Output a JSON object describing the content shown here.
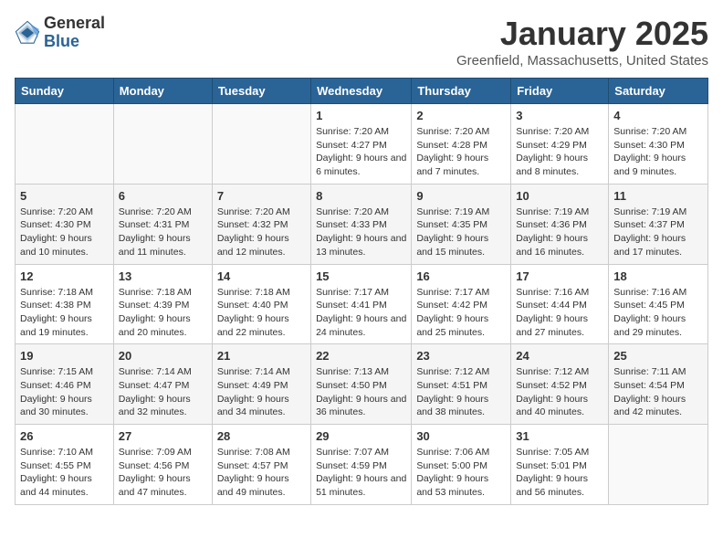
{
  "header": {
    "logo": {
      "general": "General",
      "blue": "Blue"
    },
    "title": "January 2025",
    "subtitle": "Greenfield, Massachusetts, United States"
  },
  "weekdays": [
    "Sunday",
    "Monday",
    "Tuesday",
    "Wednesday",
    "Thursday",
    "Friday",
    "Saturday"
  ],
  "weeks": [
    [
      {
        "day": "",
        "info": ""
      },
      {
        "day": "",
        "info": ""
      },
      {
        "day": "",
        "info": ""
      },
      {
        "day": "1",
        "info": "Sunrise: 7:20 AM\nSunset: 4:27 PM\nDaylight: 9 hours and 6 minutes."
      },
      {
        "day": "2",
        "info": "Sunrise: 7:20 AM\nSunset: 4:28 PM\nDaylight: 9 hours and 7 minutes."
      },
      {
        "day": "3",
        "info": "Sunrise: 7:20 AM\nSunset: 4:29 PM\nDaylight: 9 hours and 8 minutes."
      },
      {
        "day": "4",
        "info": "Sunrise: 7:20 AM\nSunset: 4:30 PM\nDaylight: 9 hours and 9 minutes."
      }
    ],
    [
      {
        "day": "5",
        "info": "Sunrise: 7:20 AM\nSunset: 4:30 PM\nDaylight: 9 hours and 10 minutes."
      },
      {
        "day": "6",
        "info": "Sunrise: 7:20 AM\nSunset: 4:31 PM\nDaylight: 9 hours and 11 minutes."
      },
      {
        "day": "7",
        "info": "Sunrise: 7:20 AM\nSunset: 4:32 PM\nDaylight: 9 hours and 12 minutes."
      },
      {
        "day": "8",
        "info": "Sunrise: 7:20 AM\nSunset: 4:33 PM\nDaylight: 9 hours and 13 minutes."
      },
      {
        "day": "9",
        "info": "Sunrise: 7:19 AM\nSunset: 4:35 PM\nDaylight: 9 hours and 15 minutes."
      },
      {
        "day": "10",
        "info": "Sunrise: 7:19 AM\nSunset: 4:36 PM\nDaylight: 9 hours and 16 minutes."
      },
      {
        "day": "11",
        "info": "Sunrise: 7:19 AM\nSunset: 4:37 PM\nDaylight: 9 hours and 17 minutes."
      }
    ],
    [
      {
        "day": "12",
        "info": "Sunrise: 7:18 AM\nSunset: 4:38 PM\nDaylight: 9 hours and 19 minutes."
      },
      {
        "day": "13",
        "info": "Sunrise: 7:18 AM\nSunset: 4:39 PM\nDaylight: 9 hours and 20 minutes."
      },
      {
        "day": "14",
        "info": "Sunrise: 7:18 AM\nSunset: 4:40 PM\nDaylight: 9 hours and 22 minutes."
      },
      {
        "day": "15",
        "info": "Sunrise: 7:17 AM\nSunset: 4:41 PM\nDaylight: 9 hours and 24 minutes."
      },
      {
        "day": "16",
        "info": "Sunrise: 7:17 AM\nSunset: 4:42 PM\nDaylight: 9 hours and 25 minutes."
      },
      {
        "day": "17",
        "info": "Sunrise: 7:16 AM\nSunset: 4:44 PM\nDaylight: 9 hours and 27 minutes."
      },
      {
        "day": "18",
        "info": "Sunrise: 7:16 AM\nSunset: 4:45 PM\nDaylight: 9 hours and 29 minutes."
      }
    ],
    [
      {
        "day": "19",
        "info": "Sunrise: 7:15 AM\nSunset: 4:46 PM\nDaylight: 9 hours and 30 minutes."
      },
      {
        "day": "20",
        "info": "Sunrise: 7:14 AM\nSunset: 4:47 PM\nDaylight: 9 hours and 32 minutes."
      },
      {
        "day": "21",
        "info": "Sunrise: 7:14 AM\nSunset: 4:49 PM\nDaylight: 9 hours and 34 minutes."
      },
      {
        "day": "22",
        "info": "Sunrise: 7:13 AM\nSunset: 4:50 PM\nDaylight: 9 hours and 36 minutes."
      },
      {
        "day": "23",
        "info": "Sunrise: 7:12 AM\nSunset: 4:51 PM\nDaylight: 9 hours and 38 minutes."
      },
      {
        "day": "24",
        "info": "Sunrise: 7:12 AM\nSunset: 4:52 PM\nDaylight: 9 hours and 40 minutes."
      },
      {
        "day": "25",
        "info": "Sunrise: 7:11 AM\nSunset: 4:54 PM\nDaylight: 9 hours and 42 minutes."
      }
    ],
    [
      {
        "day": "26",
        "info": "Sunrise: 7:10 AM\nSunset: 4:55 PM\nDaylight: 9 hours and 44 minutes."
      },
      {
        "day": "27",
        "info": "Sunrise: 7:09 AM\nSunset: 4:56 PM\nDaylight: 9 hours and 47 minutes."
      },
      {
        "day": "28",
        "info": "Sunrise: 7:08 AM\nSunset: 4:57 PM\nDaylight: 9 hours and 49 minutes."
      },
      {
        "day": "29",
        "info": "Sunrise: 7:07 AM\nSunset: 4:59 PM\nDaylight: 9 hours and 51 minutes."
      },
      {
        "day": "30",
        "info": "Sunrise: 7:06 AM\nSunset: 5:00 PM\nDaylight: 9 hours and 53 minutes."
      },
      {
        "day": "31",
        "info": "Sunrise: 7:05 AM\nSunset: 5:01 PM\nDaylight: 9 hours and 56 minutes."
      },
      {
        "day": "",
        "info": ""
      }
    ]
  ]
}
